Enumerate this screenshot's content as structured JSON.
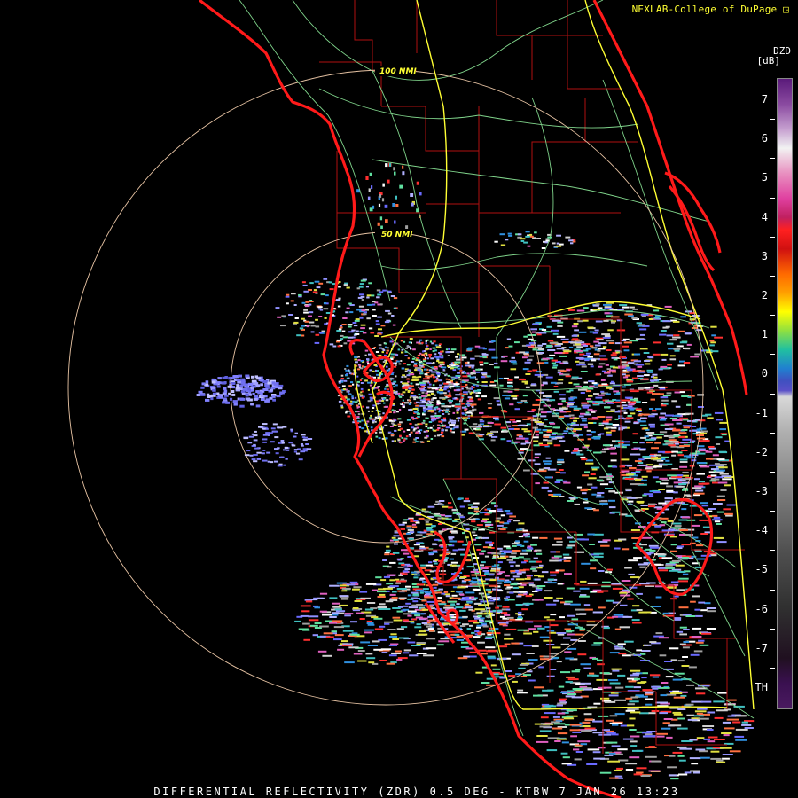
{
  "header": {
    "credit": "NEXLAB-College of DuPage",
    "credit_icon": "cursor-arrow-icon"
  },
  "footer": {
    "caption": "DIFFERENTIAL REFLECTIVITY (ZDR) 0.5 DEG - KTBW 7 JAN 26 13:23"
  },
  "legend": {
    "product": "DZD",
    "unit": "[dB]",
    "ticks": [
      "7",
      "6",
      "5",
      "4",
      "3",
      "2",
      "1",
      "0",
      "-1",
      "-2",
      "-3",
      "-4",
      "-5",
      "-6",
      "-7",
      "TH"
    ]
  },
  "rings": {
    "inner": "50 NMI",
    "outer": "100 NMI"
  },
  "colors": {
    "coast": "#ff1a1a",
    "county": "#b01010",
    "highway": "#ffff33",
    "road": "#7fd38a",
    "ring": "#e8c4a4"
  }
}
